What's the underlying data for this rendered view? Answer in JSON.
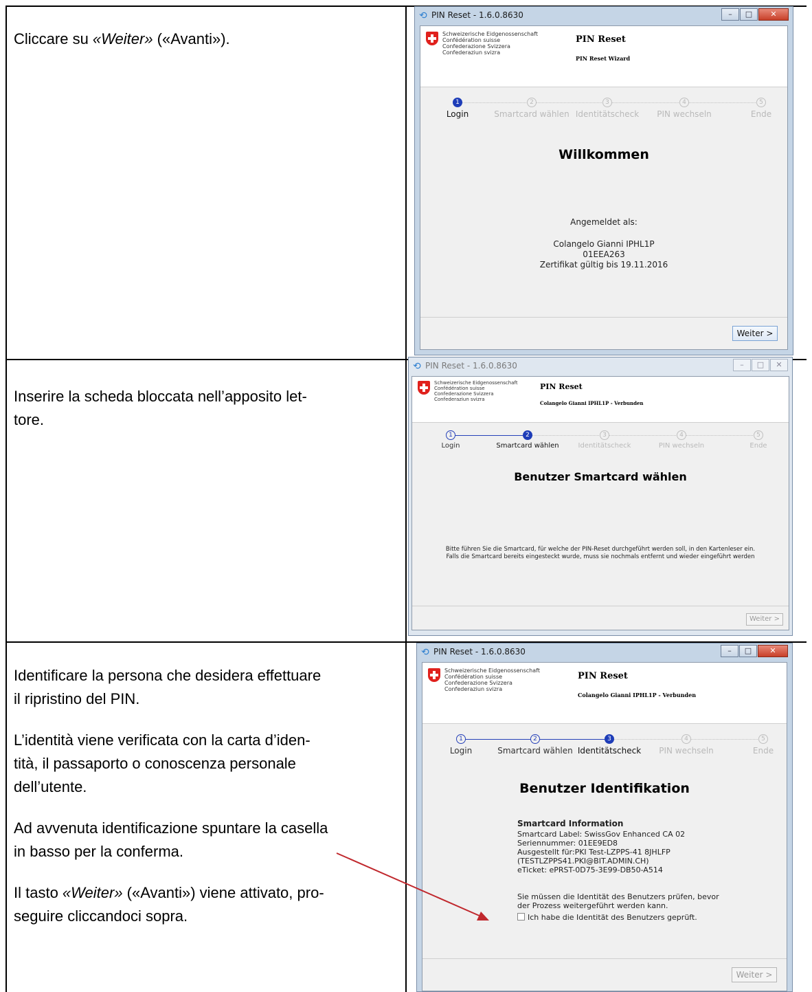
{
  "rows": [
    {
      "paragraphs": [
        "Cliccare su «Weiter» («Avanti»)."
      ],
      "italic_terms": [
        "«Weiter»"
      ]
    },
    {
      "paragraphs": [
        "Inserire la scheda bloccata nell’apposito let-tore."
      ]
    },
    {
      "paragraphs": [
        "Identificare la persona che desidera effettuare il ripristino del PIN.",
        "L’identità viene verificata con la carta d’iden-tità, il passaporto o conoscenza personale dell’utente.",
        "Ad avvenuta identificazione spuntare la casella in basso per la conferma.",
        "Il tasto «Weiter» («Avanti») viene attivato, pro-seguire cliccandoci sopra."
      ]
    }
  ],
  "row1": {
    "p1a": "Cliccare su ",
    "p1b": "«Weiter»",
    "p1c": " («Avanti»)."
  },
  "row2": {
    "line1": "Inserire la scheda bloccata nell’apposito let-",
    "line2": "tore."
  },
  "row3": {
    "p1l1": "Identificare la persona che desidera effettuare",
    "p1l2": "il ripristino del PIN.",
    "p2l1": "L’identità viene verificata con la carta d’iden-",
    "p2l2": "tità, il passaporto o conoscenza personale",
    "p2l3": "dell’utente.",
    "p3l1": "Ad avvenuta identificazione spuntare la casella",
    "p3l2": "in basso per la conferma.",
    "p4a": "Il tasto ",
    "p4b": "«Weiter»",
    "p4c": " («Avanti») viene attivato, pro-",
    "p4l2": "seguire cliccandoci sopra."
  },
  "gov_lines": [
    "Schweizerische Eidgenossenschaft",
    "Confédération suisse",
    "Confederazione Svizzera",
    "Confederaziun svizra"
  ],
  "steps": [
    "Login",
    "Smartcard wählen",
    "Identitätscheck",
    "PIN wechseln",
    "Ende"
  ],
  "step_numbers": [
    "1",
    "2",
    "3",
    "4",
    "5"
  ],
  "window1": {
    "title": "PIN Reset - 1.6.0.8630",
    "header_title": "PIN Reset",
    "header_sub": "PIN Reset Wizard",
    "heading": "Willkommen",
    "logged_label": "Angemeldet als:",
    "user": "Colangelo Gianni IPHL1P",
    "serial": "01EEA263",
    "cert": "Zertifikat gültig bis 19.11.2016",
    "button": "Weiter >",
    "active_step": 1
  },
  "window2": {
    "title": "PIN Reset - 1.6.0.8630",
    "header_title": "PIN Reset",
    "header_sub": "Colangelo Gianni IPHL1P - Verbunden",
    "heading": "Benutzer Smartcard wählen",
    "text1": "Bitte führen Sie die Smartcard, für welche der PIN-Reset durchgeführt werden soll, in den Kartenleser ein.",
    "text2": "Falls die Smartcard bereits eingesteckt wurde, muss sie nochmals entfernt und wieder eingeführt werden",
    "button": "Weiter >",
    "active_step": 2
  },
  "window3": {
    "title": "PIN Reset - 1.6.0.8630",
    "header_title": "PIN Reset",
    "header_sub": "Colangelo Gianni IPHL1P - Verbunden",
    "heading": "Benutzer Identifikation",
    "info_heading": "Smartcard Information",
    "info_lines": [
      "Smartcard Label: SwissGov Enhanced CA 02",
      "Seriennummer: 01EE9ED8",
      "Ausgestellt für:PKI Test-LZPPS-41 8JHLFP",
      "(TESTLZPPS41.PKI@BIT.ADMIN.CH)",
      "eTicket: ePRST-0D75-3E99-DB50-A514"
    ],
    "notice1": "Sie müssen die Identität des Benutzers prüfen, bevor",
    "notice2": "der Prozess weitergeführt werden kann.",
    "checkbox_label": "Ich habe die Identität des Benutzers geprüft.",
    "checkbox_checked": false,
    "button": "Weiter >",
    "active_step": 3
  },
  "annotation_arrow_color": "#c0282d"
}
